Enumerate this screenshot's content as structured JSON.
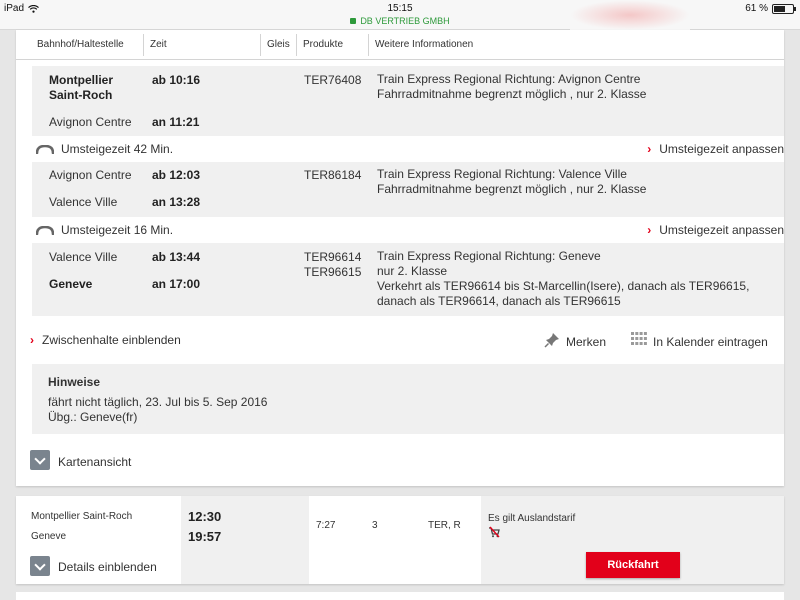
{
  "status_bar": {
    "device": "iPad",
    "time": "15:15",
    "site": "DB VERTRIEB GMBH",
    "battery": "61 %",
    "battery_level": 0.61
  },
  "table_headers": [
    "Bahnhof/Haltestelle",
    "Zeit",
    "Gleis",
    "Produkte",
    "Weitere Informationen"
  ],
  "segments": [
    {
      "dep_station": "Montpellier",
      "dep_station_line2": "Saint-Roch",
      "dep_time": "ab 10:16",
      "arr_station": "Avignon Centre",
      "arr_time": "an 11:21",
      "products": [
        "TER76408"
      ],
      "info": [
        "Train Express Regional Richtung: Avignon Centre",
        "Fahrradmitnahme begrenzt möglich , nur 2. Klasse"
      ]
    },
    {
      "dep_station": "Avignon Centre",
      "dep_time": "ab 12:03",
      "arr_station": "Valence Ville",
      "arr_time": "an 13:28",
      "products": [
        "TER86184"
      ],
      "info": [
        "Train Express Regional Richtung: Valence Ville",
        "Fahrradmitnahme begrenzt möglich , nur 2. Klasse"
      ]
    },
    {
      "dep_station": "Valence Ville",
      "dep_time": "ab 13:44",
      "arr_station": "Geneve",
      "arr_time": "an 17:00",
      "products": [
        "TER96614",
        "TER96615"
      ],
      "info": [
        "Train Express Regional Richtung: Geneve",
        "nur 2. Klasse",
        "Verkehrt als TER96614 bis St-Marcellin(Isere), danach als TER96615,",
        "danach als TER96614, danach als TER96615"
      ]
    }
  ],
  "transfers": [
    {
      "label": "Umsteigezeit 42 Min.",
      "link": "Umsteigezeit anpassen"
    },
    {
      "label": "Umsteigezeit 16 Min.",
      "link": "Umsteigezeit anpassen"
    }
  ],
  "actions": {
    "zwischenhalte": "Zwischenhalte einblenden",
    "merken": "Merken",
    "kalender": "In Kalender eintragen"
  },
  "hinweise": {
    "title": "Hinweise",
    "lines": [
      "fährt nicht täglich, 23. Jul bis 5. Sep 2016",
      "Übg.: Geneve(fr)"
    ]
  },
  "kartenansicht": "Kartenansicht",
  "summary": {
    "from": "Montpellier Saint-Roch",
    "to": "Geneve",
    "dep": "12:30",
    "arr": "19:57",
    "duration": "7:27",
    "changes": "3",
    "products": "TER, R",
    "tarif": "Es gilt Auslandstarif",
    "details_label": "Details einblenden",
    "return_label": "Rückfahrt"
  },
  "colors": {
    "accent": "#e2001a",
    "secure": "#2e9a3b",
    "row_bg": "#f0f0f0",
    "button_grey": "#7a848e"
  }
}
